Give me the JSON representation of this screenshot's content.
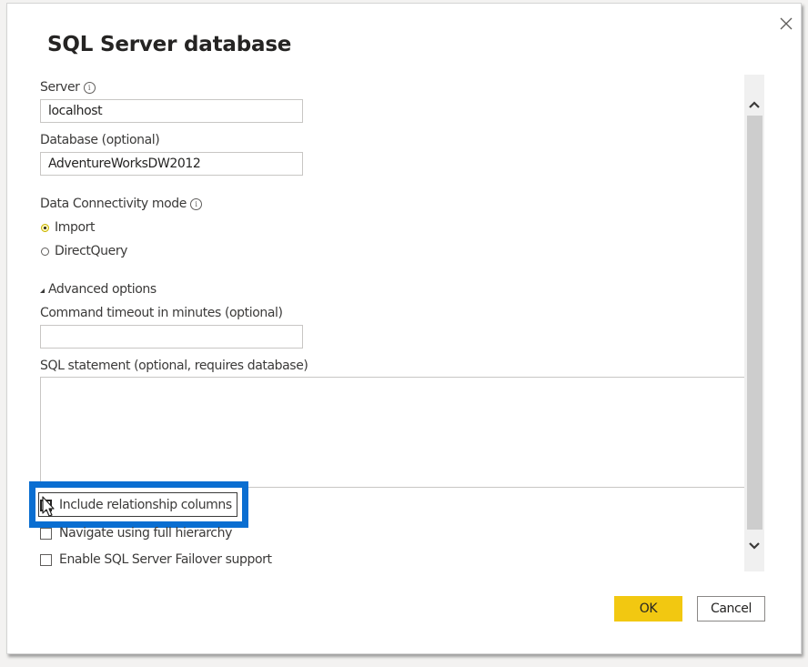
{
  "dialog": {
    "title": "SQL Server database",
    "close_icon": "close-icon"
  },
  "server": {
    "label": "Server",
    "info_icon": "info-icon",
    "value": "localhost"
  },
  "database": {
    "label": "Database (optional)",
    "value": "AdventureWorksDW2012"
  },
  "connectivity": {
    "label": "Data Connectivity mode",
    "info_icon": "info-icon",
    "options": [
      {
        "label": "Import",
        "selected": true
      },
      {
        "label": "DirectQuery",
        "selected": false
      }
    ]
  },
  "advanced": {
    "toggle_label": "Advanced options",
    "expanded": true,
    "timeout": {
      "label": "Command timeout in minutes (optional)",
      "value": ""
    },
    "sql": {
      "label": "SQL statement (optional, requires database)",
      "value": ""
    },
    "checkboxes": [
      {
        "label": "Include relationship columns",
        "checked": false,
        "highlighted": true
      },
      {
        "label": "Navigate using full hierarchy",
        "checked": false
      },
      {
        "label": "Enable SQL Server Failover support",
        "checked": false
      }
    ]
  },
  "highlight_color": "#0a6ed1",
  "accent_color": "#f2c811",
  "footer": {
    "ok_label": "OK",
    "cancel_label": "Cancel"
  }
}
